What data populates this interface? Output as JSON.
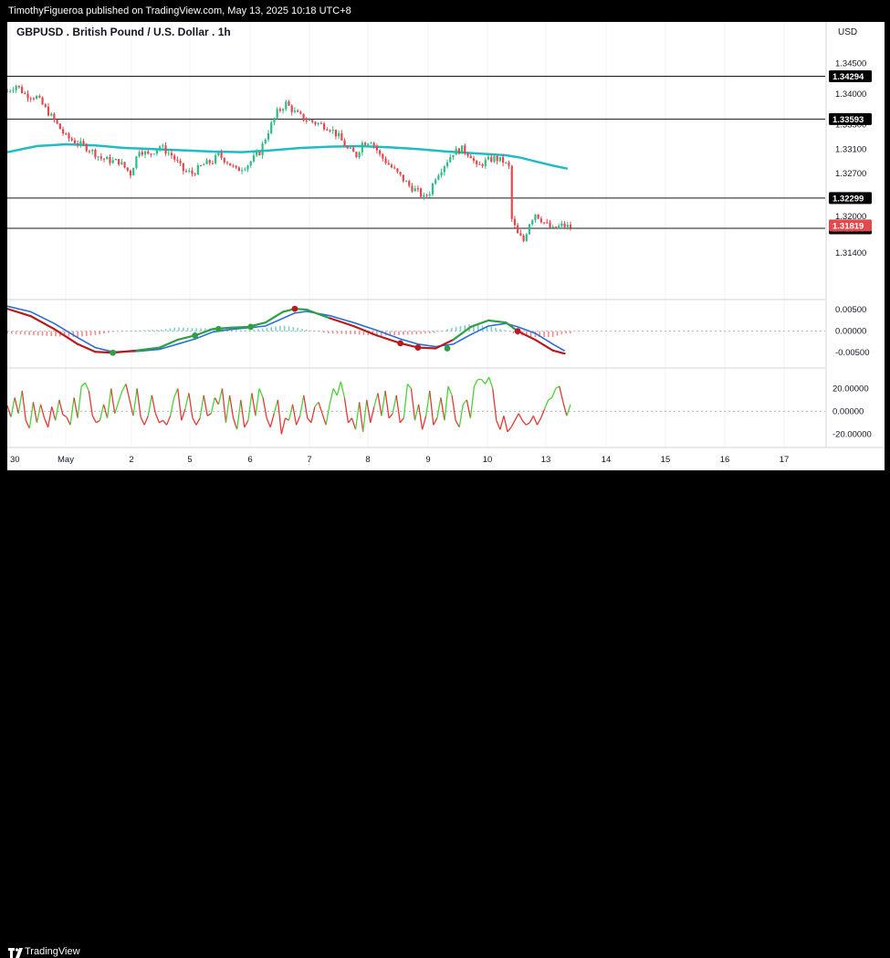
{
  "header": {
    "publisher_line": "TimothyFigueroa published on TradingView.com, May 13, 2025 10:18 UTC+8"
  },
  "footer": {
    "brand": "TradingView"
  },
  "colors": {
    "candle_up": "#2ebd85",
    "candle_down": "#e2494d",
    "ma_line": "#1fbcc6",
    "macd_fast": "#2f9e44",
    "macd_slow": "#2b6fd6",
    "macd_red": "#b71c1c",
    "osc_up": "#4cd137",
    "osc_down": "#e53935",
    "price_tag": "#e2494d",
    "level_tag": "#000000"
  },
  "chart_data": [
    {
      "type": "candlestick",
      "title": "GBPUSD . British Pound / U.S. Dollar . 1h",
      "currency_label": "USD",
      "ylim": [
        1.311,
        1.3475
      ],
      "y_ticks": [
        "1.34500",
        "1.34000",
        "1.33500",
        "1.33100",
        "1.32700",
        "1.32000",
        "1.31400"
      ],
      "x_ticks": [
        "30",
        "May",
        "2",
        "5",
        "6",
        "7",
        "8",
        "9",
        "10",
        "13",
        "14",
        "15",
        "16",
        "17"
      ],
      "horizontal_levels": [
        {
          "label": "1.34294",
          "value": 1.34294
        },
        {
          "label": "1.33593",
          "value": 1.33593
        },
        {
          "label": "1.32299",
          "value": 1.32299
        },
        {
          "label": "1.31804",
          "value": 1.31804
        }
      ],
      "last_price": {
        "label": "1.31819",
        "value": 1.31819
      },
      "close_path": [
        [
          0,
          1.3405
        ],
        [
          3,
          1.3415
        ],
        [
          6,
          1.34
        ],
        [
          10,
          1.3395
        ],
        [
          14,
          1.337
        ],
        [
          17,
          1.335
        ],
        [
          20,
          1.333
        ],
        [
          24,
          1.332
        ],
        [
          28,
          1.331
        ],
        [
          32,
          1.3295
        ],
        [
          36,
          1.329
        ],
        [
          38,
          1.329
        ],
        [
          42,
          1.327
        ],
        [
          45,
          1.331
        ],
        [
          48,
          1.33
        ],
        [
          52,
          1.3315
        ],
        [
          56,
          1.33
        ],
        [
          60,
          1.3275
        ],
        [
          63,
          1.327
        ],
        [
          67,
          1.3285
        ],
        [
          70,
          1.329
        ],
        [
          72,
          1.33
        ],
        [
          75,
          1.329
        ],
        [
          78,
          1.3275
        ],
        [
          82,
          1.3285
        ],
        [
          86,
          1.3305
        ],
        [
          89,
          1.334
        ],
        [
          92,
          1.337
        ],
        [
          95,
          1.3385
        ],
        [
          98,
          1.337
        ],
        [
          101,
          1.336
        ],
        [
          104,
          1.3355
        ],
        [
          107,
          1.335
        ],
        [
          110,
          1.3345
        ],
        [
          113,
          1.333
        ],
        [
          116,
          1.331
        ],
        [
          119,
          1.33
        ],
        [
          121,
          1.332
        ],
        [
          124,
          1.3325
        ],
        [
          127,
          1.33
        ],
        [
          130,
          1.3285
        ],
        [
          133,
          1.327
        ],
        [
          137,
          1.325
        ],
        [
          140,
          1.324
        ],
        [
          142,
          1.323
        ],
        [
          144,
          1.324
        ],
        [
          146,
          1.3265
        ],
        [
          149,
          1.3285
        ],
        [
          152,
          1.3305
        ],
        [
          155,
          1.331
        ],
        [
          158,
          1.33
        ],
        [
          160,
          1.328
        ],
        [
          163,
          1.329
        ],
        [
          166,
          1.3295
        ],
        [
          169,
          1.329
        ],
        [
          171,
          1.328
        ],
        [
          172,
          1.3195
        ],
        [
          174,
          1.317
        ],
        [
          176,
          1.316
        ],
        [
          178,
          1.319
        ],
        [
          180,
          1.3205
        ],
        [
          183,
          1.319
        ],
        [
          186,
          1.3178
        ],
        [
          189,
          1.3185
        ],
        [
          192,
          1.3182
        ]
      ],
      "ma_path": [
        [
          0,
          1.3305
        ],
        [
          10,
          1.3315
        ],
        [
          20,
          1.3318
        ],
        [
          30,
          1.3316
        ],
        [
          40,
          1.3312
        ],
        [
          50,
          1.331
        ],
        [
          60,
          1.3308
        ],
        [
          70,
          1.3306
        ],
        [
          80,
          1.3305
        ],
        [
          90,
          1.3308
        ],
        [
          100,
          1.3312
        ],
        [
          110,
          1.3314
        ],
        [
          120,
          1.3315
        ],
        [
          130,
          1.3313
        ],
        [
          140,
          1.331
        ],
        [
          150,
          1.3306
        ],
        [
          160,
          1.3303
        ],
        [
          170,
          1.33
        ],
        [
          175,
          1.3296
        ],
        [
          180,
          1.329
        ],
        [
          186,
          1.3283
        ],
        [
          191,
          1.3278
        ]
      ]
    },
    {
      "type": "line",
      "name": "MACD panel",
      "ylim": [
        -0.0075,
        0.0065
      ],
      "y_ticks": [
        "0.00500",
        "0.00000",
        "-0.00500"
      ],
      "fast_path": [
        [
          0,
          0.0052
        ],
        [
          8,
          0.0035
        ],
        [
          16,
          0.0005
        ],
        [
          24,
          -0.003
        ],
        [
          30,
          -0.0048
        ],
        [
          36,
          -0.005
        ],
        [
          44,
          -0.0045
        ],
        [
          52,
          -0.0038
        ],
        [
          58,
          -0.002
        ],
        [
          64,
          -0.001
        ],
        [
          70,
          0.0005
        ],
        [
          76,
          0.0008
        ],
        [
          82,
          0.001
        ],
        [
          88,
          0.002
        ],
        [
          94,
          0.0045
        ],
        [
          98,
          0.0052
        ],
        [
          102,
          0.005
        ],
        [
          110,
          0.003
        ],
        [
          118,
          0.0012
        ],
        [
          126,
          -0.001
        ],
        [
          134,
          -0.0028
        ],
        [
          140,
          -0.0038
        ],
        [
          146,
          -0.004
        ],
        [
          152,
          -0.002
        ],
        [
          158,
          0.001
        ],
        [
          164,
          0.0025
        ],
        [
          170,
          0.002
        ],
        [
          174,
          0.0
        ],
        [
          180,
          -0.002
        ],
        [
          186,
          -0.0045
        ],
        [
          190,
          -0.0052
        ]
      ],
      "slow_path": [
        [
          0,
          0.0058
        ],
        [
          8,
          0.0045
        ],
        [
          16,
          0.0018
        ],
        [
          24,
          -0.0015
        ],
        [
          30,
          -0.0038
        ],
        [
          36,
          -0.0048
        ],
        [
          44,
          -0.0047
        ],
        [
          52,
          -0.0042
        ],
        [
          58,
          -0.003
        ],
        [
          64,
          -0.0018
        ],
        [
          70,
          -0.0002
        ],
        [
          76,
          0.0004
        ],
        [
          82,
          0.0008
        ],
        [
          88,
          0.0012
        ],
        [
          94,
          0.003
        ],
        [
          98,
          0.0042
        ],
        [
          102,
          0.0046
        ],
        [
          110,
          0.0036
        ],
        [
          118,
          0.002
        ],
        [
          126,
          0.0002
        ],
        [
          134,
          -0.0018
        ],
        [
          140,
          -0.003
        ],
        [
          146,
          -0.0036
        ],
        [
          152,
          -0.003
        ],
        [
          158,
          -0.0008
        ],
        [
          164,
          0.0012
        ],
        [
          170,
          0.0018
        ],
        [
          174,
          0.001
        ],
        [
          180,
          -0.0005
        ],
        [
          186,
          -0.003
        ],
        [
          190,
          -0.0046
        ]
      ],
      "cross_points": [
        [
          36,
          -0.005
        ],
        [
          64,
          -0.001
        ],
        [
          72,
          0.0005
        ],
        [
          83,
          0.001
        ],
        [
          98,
          0.0052
        ],
        [
          134,
          -0.0028
        ],
        [
          140,
          -0.0038
        ],
        [
          150,
          -0.004
        ],
        [
          174,
          0.0
        ]
      ]
    },
    {
      "type": "line",
      "name": "Oscillator panel",
      "ylim": [
        -27,
        34
      ],
      "y_ticks": [
        "20.00000",
        "0.00000",
        "-20.00000"
      ],
      "values": [
        5,
        -5,
        12,
        -2,
        18,
        -8,
        -15,
        8,
        -10,
        6,
        -6,
        -14,
        4,
        -8,
        10,
        -3,
        -5,
        -12,
        12,
        -6,
        22,
        25,
        18,
        -4,
        -10,
        -8,
        6,
        -6,
        20,
        -2,
        8,
        18,
        24,
        10,
        -4,
        20,
        -5,
        -12,
        -4,
        14,
        -2,
        -10,
        -8,
        -12,
        -4,
        12,
        20,
        -8,
        2,
        16,
        -6,
        -12,
        -6,
        14,
        -4,
        -2,
        12,
        6,
        20,
        -10,
        14,
        -6,
        -16,
        10,
        -14,
        -8,
        16,
        -4,
        20,
        12,
        -6,
        -14,
        -2,
        10,
        -20,
        -6,
        -8,
        6,
        -12,
        -4,
        14,
        -6,
        -10,
        4,
        8,
        -2,
        -12,
        6,
        20,
        14,
        26,
        12,
        -10,
        -6,
        -16,
        8,
        -18,
        10,
        -10,
        4,
        16,
        -4,
        18,
        -6,
        -2,
        14,
        -10,
        -6,
        24,
        20,
        -8,
        6,
        -16,
        -4,
        18,
        -12,
        -6,
        12,
        -8,
        22,
        14,
        -8,
        -14,
        6,
        10,
        -6,
        22,
        28,
        28,
        24,
        30,
        20,
        -8,
        -16,
        -4,
        -18,
        -14,
        -8,
        -2,
        -8,
        -12,
        -10,
        -4,
        -12,
        -6,
        2,
        10,
        12,
        20,
        22,
        8,
        -4,
        6
      ]
    }
  ]
}
